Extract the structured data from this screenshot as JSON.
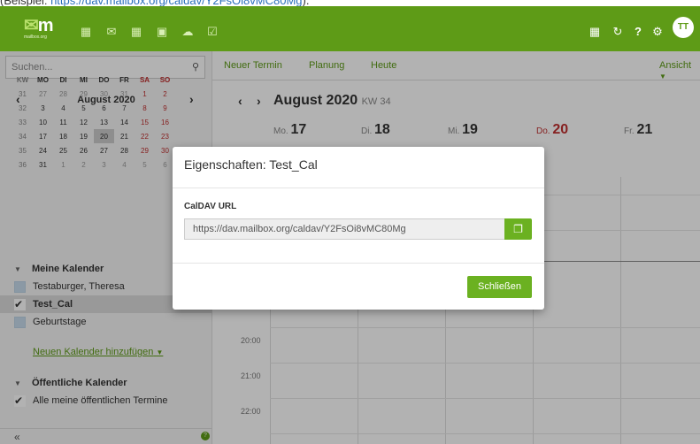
{
  "caption": {
    "prefix": "(Beispiel: ",
    "link": "https://dav.mailbox.org/caldav/Y2FsOi8vMC80Mg",
    "suffix": ")."
  },
  "app": {
    "logo_text": "m",
    "logo_sub": "mailbox.org",
    "avatar": "TT"
  },
  "topbar": {
    "icons": [
      "portal-icon",
      "mail-icon",
      "calendar-icon",
      "contacts-icon",
      "drive-icon",
      "tasks-icon"
    ],
    "right_icons": [
      "apps-grid-icon",
      "refresh-icon",
      "help-icon",
      "settings-icon"
    ]
  },
  "sidebar": {
    "search_placeholder": "Suchen...",
    "month_title": "August 2020",
    "weekdays": [
      "KW",
      "MO",
      "DI",
      "MI",
      "DO",
      "FR",
      "SA",
      "SO"
    ],
    "weeks": [
      [
        "31",
        "27",
        "28",
        "29",
        "30",
        "31",
        "1",
        "2"
      ],
      [
        "32",
        "3",
        "4",
        "5",
        "6",
        "7",
        "8",
        "9"
      ],
      [
        "33",
        "10",
        "11",
        "12",
        "13",
        "14",
        "15",
        "16"
      ],
      [
        "34",
        "17",
        "18",
        "19",
        "20",
        "21",
        "22",
        "23"
      ],
      [
        "35",
        "24",
        "25",
        "26",
        "27",
        "28",
        "29",
        "30"
      ],
      [
        "36",
        "31",
        "1",
        "2",
        "3",
        "4",
        "5",
        "6"
      ]
    ],
    "my_calendars_title": "Meine Kalender",
    "calendars": [
      {
        "label": "Testaburger, Theresa",
        "checked": false
      },
      {
        "label": "Test_Cal",
        "checked": true
      },
      {
        "label": "Geburtstage",
        "checked": false
      }
    ],
    "add_calendar": "Neuen Kalender hinzufügen",
    "public_title": "Öffentliche Kalender",
    "public_items": [
      {
        "label": "Alle meine öffentlichen Termine",
        "checked": true
      }
    ],
    "collapse": "«"
  },
  "toolbar": {
    "new_event": "Neuer Termin",
    "planning": "Planung",
    "today": "Heute",
    "view": "Ansicht"
  },
  "calendar": {
    "month": "August 2020",
    "week_label": "KW 34",
    "days": [
      {
        "dow": "Mo.",
        "num": "17"
      },
      {
        "dow": "Di.",
        "num": "18"
      },
      {
        "dow": "Mi.",
        "num": "19"
      },
      {
        "dow": "Do.",
        "num": "20"
      },
      {
        "dow": "Fr.",
        "num": "21"
      }
    ],
    "hours": [
      "20:00",
      "21:00",
      "22:00"
    ]
  },
  "modal": {
    "title": "Eigenschaften: Test_Cal",
    "field_label": "CalDAV URL",
    "url": "https://dav.mailbox.org/caldav/Y2FsOi8vMC80Mg",
    "close_label": "Schließen"
  }
}
